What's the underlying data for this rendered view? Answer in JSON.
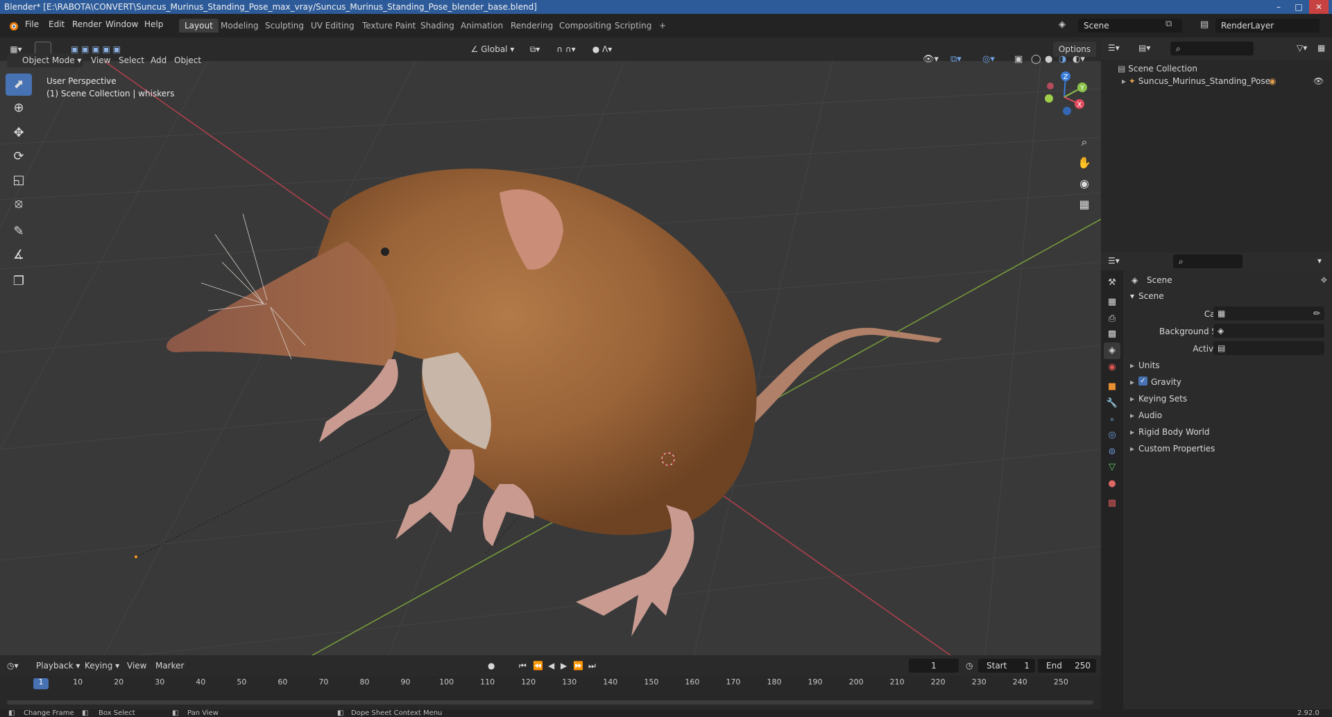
{
  "window": {
    "title": "Blender* [E:\\RABOTA\\CONVERT\\Suncus_Murinus_Standing_Pose_max_vray/Suncus_Murinus_Standing_Pose_blender_base.blend]",
    "minimize": "–",
    "maximize": "□",
    "close": "✕"
  },
  "menu": [
    "File",
    "Edit",
    "Render",
    "Window",
    "Help"
  ],
  "workspaces": [
    "Layout",
    "Modeling",
    "Sculpting",
    "UV Editing",
    "Texture Paint",
    "Shading",
    "Animation",
    "Rendering",
    "Compositing",
    "Scripting"
  ],
  "add_workspace": "+",
  "scene_selector": "Scene",
  "renderlayer_selector": "RenderLayer",
  "viewport": {
    "mode": "Object Mode",
    "header_menus": [
      "View",
      "Select",
      "Add",
      "Object"
    ],
    "orientation": "Global",
    "options": "Options",
    "perspective_label": "User Perspective",
    "collection_label": "(1) Scene Collection | whiskers",
    "gizmo_axes": [
      "Z",
      "Y",
      "X"
    ]
  },
  "outliner": {
    "root": "Scene Collection",
    "items": [
      "Suncus_Murinus_Standing_Pose"
    ]
  },
  "properties": {
    "breadcrumb": "Scene",
    "panel_title": "Scene",
    "fields": [
      {
        "label": "Camera",
        "value": ""
      },
      {
        "label": "Background Scene",
        "value": ""
      },
      {
        "label": "Active Clip",
        "value": ""
      }
    ],
    "subpanels": [
      "Units",
      "Gravity",
      "Keying Sets",
      "Audio",
      "Rigid Body World",
      "Custom Properties"
    ],
    "gravity_checked": true
  },
  "timeline": {
    "menus": [
      "Playback",
      "Keying",
      "View",
      "Marker"
    ],
    "current_frame": "1",
    "start_label": "Start",
    "start": "1",
    "end_label": "End",
    "end": "250",
    "ticks": [
      "1",
      "10",
      "20",
      "30",
      "40",
      "50",
      "60",
      "70",
      "80",
      "90",
      "100",
      "110",
      "120",
      "130",
      "140",
      "150",
      "160",
      "170",
      "180",
      "190",
      "200",
      "210",
      "220",
      "230",
      "240",
      "250"
    ]
  },
  "statusbar": {
    "items": [
      "Change Frame",
      "Box Select",
      "Pan View",
      "Dope Sheet Context Menu"
    ],
    "version": "2.92.0"
  },
  "colors": {
    "accent": "#4772b3",
    "title_bar": "#2d5b9a",
    "x_axis": "#b5404d",
    "y_axis": "#7ba03a",
    "shrew_fur": "#9a6338"
  }
}
